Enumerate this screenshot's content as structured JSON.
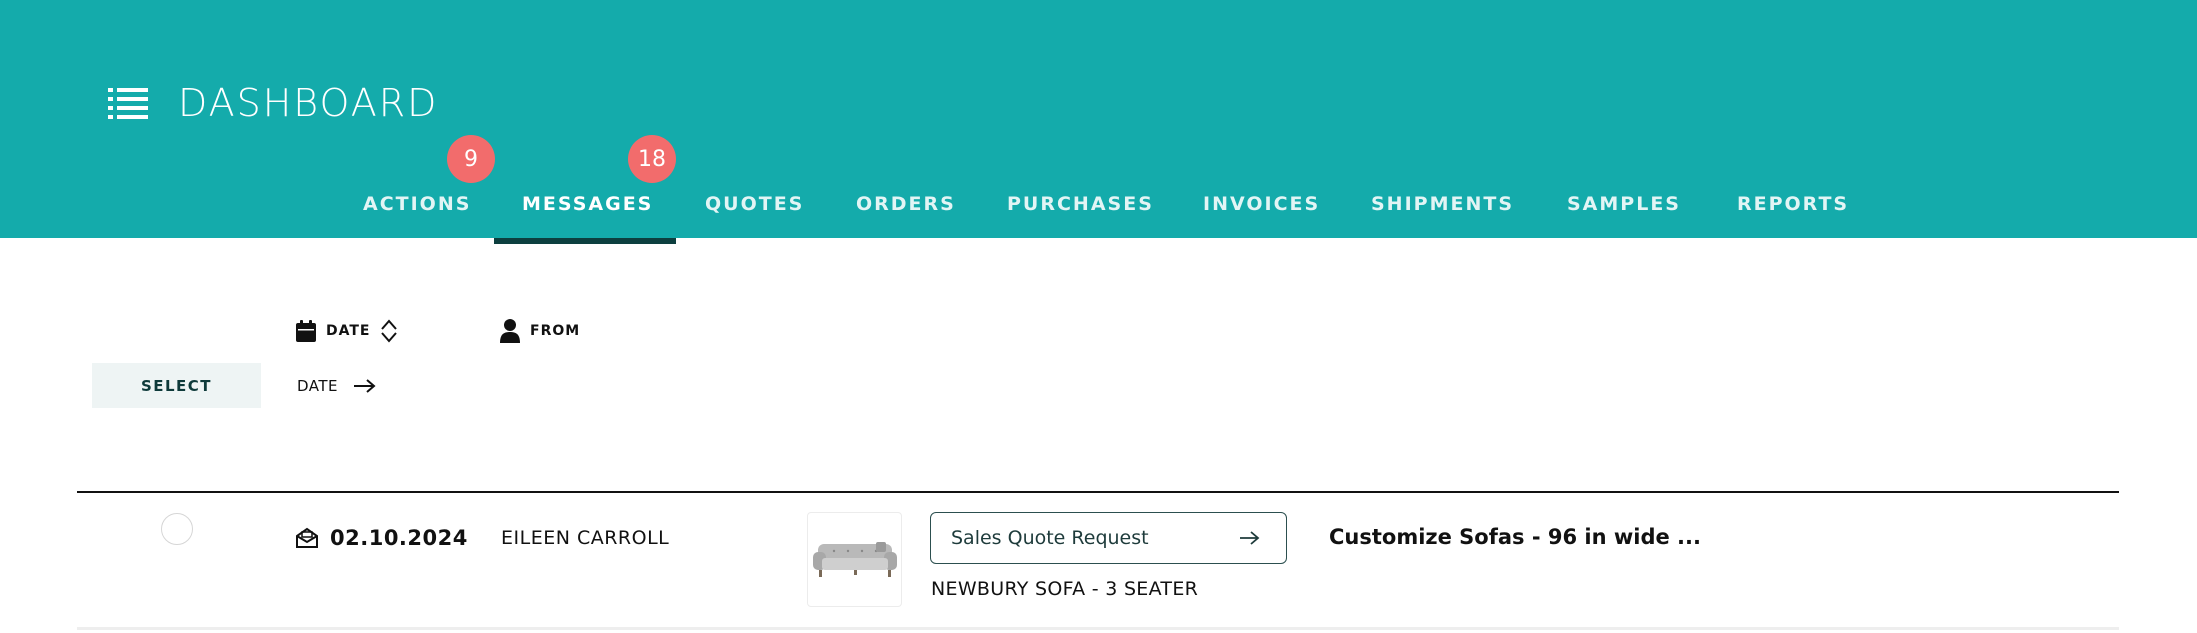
{
  "header": {
    "title": "DASHBOARD",
    "menu_icon": "list-menu-icon",
    "background": "#14abab"
  },
  "tabs": [
    {
      "label": "ACTIONS",
      "badge": "9",
      "active": false
    },
    {
      "label": "MESSAGES",
      "badge": "18",
      "active": true
    },
    {
      "label": "QUOTES",
      "active": false
    },
    {
      "label": "ORDERS",
      "active": false
    },
    {
      "label": "PURCHASES",
      "active": false
    },
    {
      "label": "INVOICES",
      "active": false
    },
    {
      "label": "SHIPMENTS",
      "active": false
    },
    {
      "label": "SAMPLES",
      "active": false
    },
    {
      "label": "REPORTS",
      "active": false
    }
  ],
  "badge_color": "#f26c6c",
  "filters": {
    "date_label": "DATE",
    "date_icon": "calendar-icon",
    "sort_icon": "sort-updown-icon",
    "from_label": "FROM",
    "from_icon": "person-icon",
    "select_label": "SELECT",
    "date_sort_label": "DATE",
    "date_sort_icon": "arrow-right-icon"
  },
  "messages": [
    {
      "date": "02.10.2024",
      "date_icon": "open-envelope-icon",
      "from": "EILEEN CARROLL",
      "thumbnail_icon": "sofa-image",
      "action_label": "Sales Quote Request",
      "action_icon": "arrow-right-icon",
      "product": "NEWBURY SOFA - 3 SEATER",
      "subject": "Customize Sofas - 96 in wide ..."
    }
  ]
}
